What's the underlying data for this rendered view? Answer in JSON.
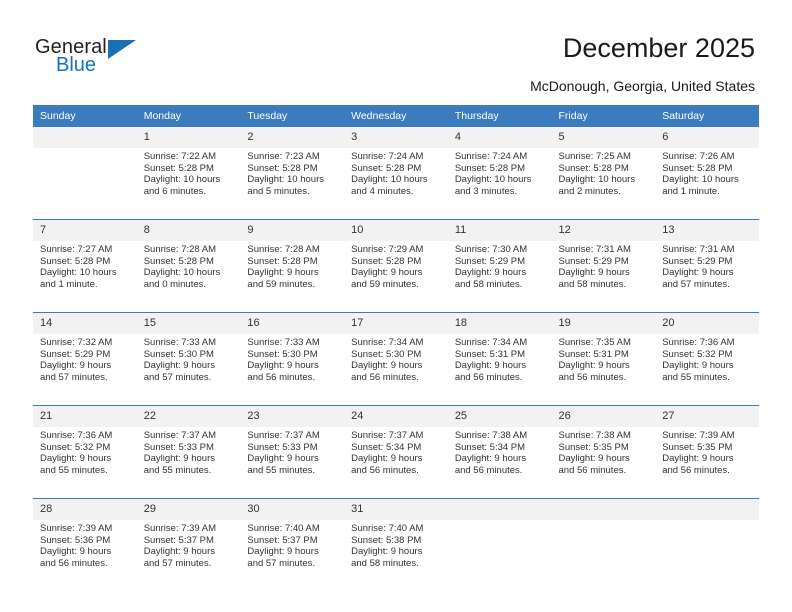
{
  "brand": {
    "name_part1": "General",
    "name_part2": "Blue",
    "triangle_color": "#1a6fb5",
    "blue_color": "#1273bf"
  },
  "header": {
    "title": "December 2025",
    "subtitle": "McDonough, Georgia, United States",
    "header_bg": "#3a7cbe"
  },
  "weekdays": [
    "Sunday",
    "Monday",
    "Tuesday",
    "Wednesday",
    "Thursday",
    "Friday",
    "Saturday"
  ],
  "weeks": [
    {
      "days": [
        {
          "num": "",
          "sunrise": "",
          "sunset": "",
          "daylight1": "",
          "daylight2": ""
        },
        {
          "num": "1",
          "sunrise": "Sunrise: 7:22 AM",
          "sunset": "Sunset: 5:28 PM",
          "daylight1": "Daylight: 10 hours",
          "daylight2": "and 6 minutes."
        },
        {
          "num": "2",
          "sunrise": "Sunrise: 7:23 AM",
          "sunset": "Sunset: 5:28 PM",
          "daylight1": "Daylight: 10 hours",
          "daylight2": "and 5 minutes."
        },
        {
          "num": "3",
          "sunrise": "Sunrise: 7:24 AM",
          "sunset": "Sunset: 5:28 PM",
          "daylight1": "Daylight: 10 hours",
          "daylight2": "and 4 minutes."
        },
        {
          "num": "4",
          "sunrise": "Sunrise: 7:24 AM",
          "sunset": "Sunset: 5:28 PM",
          "daylight1": "Daylight: 10 hours",
          "daylight2": "and 3 minutes."
        },
        {
          "num": "5",
          "sunrise": "Sunrise: 7:25 AM",
          "sunset": "Sunset: 5:28 PM",
          "daylight1": "Daylight: 10 hours",
          "daylight2": "and 2 minutes."
        },
        {
          "num": "6",
          "sunrise": "Sunrise: 7:26 AM",
          "sunset": "Sunset: 5:28 PM",
          "daylight1": "Daylight: 10 hours",
          "daylight2": "and 1 minute."
        }
      ]
    },
    {
      "days": [
        {
          "num": "7",
          "sunrise": "Sunrise: 7:27 AM",
          "sunset": "Sunset: 5:28 PM",
          "daylight1": "Daylight: 10 hours",
          "daylight2": "and 1 minute."
        },
        {
          "num": "8",
          "sunrise": "Sunrise: 7:28 AM",
          "sunset": "Sunset: 5:28 PM",
          "daylight1": "Daylight: 10 hours",
          "daylight2": "and 0 minutes."
        },
        {
          "num": "9",
          "sunrise": "Sunrise: 7:28 AM",
          "sunset": "Sunset: 5:28 PM",
          "daylight1": "Daylight: 9 hours",
          "daylight2": "and 59 minutes."
        },
        {
          "num": "10",
          "sunrise": "Sunrise: 7:29 AM",
          "sunset": "Sunset: 5:28 PM",
          "daylight1": "Daylight: 9 hours",
          "daylight2": "and 59 minutes."
        },
        {
          "num": "11",
          "sunrise": "Sunrise: 7:30 AM",
          "sunset": "Sunset: 5:29 PM",
          "daylight1": "Daylight: 9 hours",
          "daylight2": "and 58 minutes."
        },
        {
          "num": "12",
          "sunrise": "Sunrise: 7:31 AM",
          "sunset": "Sunset: 5:29 PM",
          "daylight1": "Daylight: 9 hours",
          "daylight2": "and 58 minutes."
        },
        {
          "num": "13",
          "sunrise": "Sunrise: 7:31 AM",
          "sunset": "Sunset: 5:29 PM",
          "daylight1": "Daylight: 9 hours",
          "daylight2": "and 57 minutes."
        }
      ]
    },
    {
      "days": [
        {
          "num": "14",
          "sunrise": "Sunrise: 7:32 AM",
          "sunset": "Sunset: 5:29 PM",
          "daylight1": "Daylight: 9 hours",
          "daylight2": "and 57 minutes."
        },
        {
          "num": "15",
          "sunrise": "Sunrise: 7:33 AM",
          "sunset": "Sunset: 5:30 PM",
          "daylight1": "Daylight: 9 hours",
          "daylight2": "and 57 minutes."
        },
        {
          "num": "16",
          "sunrise": "Sunrise: 7:33 AM",
          "sunset": "Sunset: 5:30 PM",
          "daylight1": "Daylight: 9 hours",
          "daylight2": "and 56 minutes."
        },
        {
          "num": "17",
          "sunrise": "Sunrise: 7:34 AM",
          "sunset": "Sunset: 5:30 PM",
          "daylight1": "Daylight: 9 hours",
          "daylight2": "and 56 minutes."
        },
        {
          "num": "18",
          "sunrise": "Sunrise: 7:34 AM",
          "sunset": "Sunset: 5:31 PM",
          "daylight1": "Daylight: 9 hours",
          "daylight2": "and 56 minutes."
        },
        {
          "num": "19",
          "sunrise": "Sunrise: 7:35 AM",
          "sunset": "Sunset: 5:31 PM",
          "daylight1": "Daylight: 9 hours",
          "daylight2": "and 56 minutes."
        },
        {
          "num": "20",
          "sunrise": "Sunrise: 7:36 AM",
          "sunset": "Sunset: 5:32 PM",
          "daylight1": "Daylight: 9 hours",
          "daylight2": "and 55 minutes."
        }
      ]
    },
    {
      "days": [
        {
          "num": "21",
          "sunrise": "Sunrise: 7:36 AM",
          "sunset": "Sunset: 5:32 PM",
          "daylight1": "Daylight: 9 hours",
          "daylight2": "and 55 minutes."
        },
        {
          "num": "22",
          "sunrise": "Sunrise: 7:37 AM",
          "sunset": "Sunset: 5:33 PM",
          "daylight1": "Daylight: 9 hours",
          "daylight2": "and 55 minutes."
        },
        {
          "num": "23",
          "sunrise": "Sunrise: 7:37 AM",
          "sunset": "Sunset: 5:33 PM",
          "daylight1": "Daylight: 9 hours",
          "daylight2": "and 55 minutes."
        },
        {
          "num": "24",
          "sunrise": "Sunrise: 7:37 AM",
          "sunset": "Sunset: 5:34 PM",
          "daylight1": "Daylight: 9 hours",
          "daylight2": "and 56 minutes."
        },
        {
          "num": "25",
          "sunrise": "Sunrise: 7:38 AM",
          "sunset": "Sunset: 5:34 PM",
          "daylight1": "Daylight: 9 hours",
          "daylight2": "and 56 minutes."
        },
        {
          "num": "26",
          "sunrise": "Sunrise: 7:38 AM",
          "sunset": "Sunset: 5:35 PM",
          "daylight1": "Daylight: 9 hours",
          "daylight2": "and 56 minutes."
        },
        {
          "num": "27",
          "sunrise": "Sunrise: 7:39 AM",
          "sunset": "Sunset: 5:35 PM",
          "daylight1": "Daylight: 9 hours",
          "daylight2": "and 56 minutes."
        }
      ]
    },
    {
      "days": [
        {
          "num": "28",
          "sunrise": "Sunrise: 7:39 AM",
          "sunset": "Sunset: 5:36 PM",
          "daylight1": "Daylight: 9 hours",
          "daylight2": "and 56 minutes."
        },
        {
          "num": "29",
          "sunrise": "Sunrise: 7:39 AM",
          "sunset": "Sunset: 5:37 PM",
          "daylight1": "Daylight: 9 hours",
          "daylight2": "and 57 minutes."
        },
        {
          "num": "30",
          "sunrise": "Sunrise: 7:40 AM",
          "sunset": "Sunset: 5:37 PM",
          "daylight1": "Daylight: 9 hours",
          "daylight2": "and 57 minutes."
        },
        {
          "num": "31",
          "sunrise": "Sunrise: 7:40 AM",
          "sunset": "Sunset: 5:38 PM",
          "daylight1": "Daylight: 9 hours",
          "daylight2": "and 58 minutes."
        },
        {
          "num": "",
          "sunrise": "",
          "sunset": "",
          "daylight1": "",
          "daylight2": ""
        },
        {
          "num": "",
          "sunrise": "",
          "sunset": "",
          "daylight1": "",
          "daylight2": ""
        },
        {
          "num": "",
          "sunrise": "",
          "sunset": "",
          "daylight1": "",
          "daylight2": ""
        }
      ]
    }
  ]
}
